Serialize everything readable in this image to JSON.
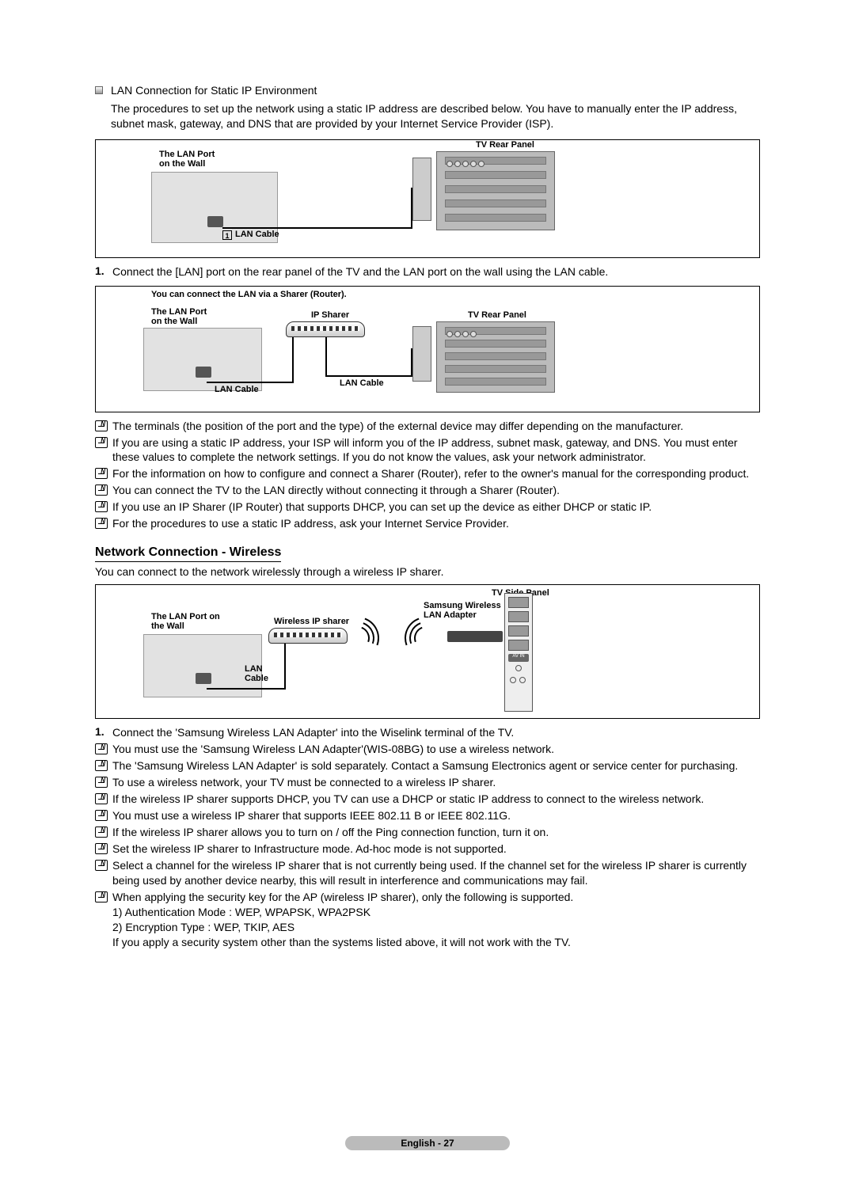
{
  "lan_static": {
    "title": "LAN Connection for Static IP Environment",
    "intro": "The procedures to set up the network using a static IP address are described below. You have to manually enter the IP address, subnet mask, gateway, and DNS that are provided by your Internet Service Provider (ISP)."
  },
  "diagram1": {
    "tv_label": "TV Rear Panel",
    "wall_label": "The LAN Port\non the Wall",
    "cable_num": "1",
    "cable_label": "LAN Cable"
  },
  "step1": {
    "num": "1.",
    "text": "Connect the [LAN] port on the rear panel of the TV and the LAN port on the wall using the LAN cable."
  },
  "diagram2": {
    "heading": "You can connect the LAN via a Sharer (Router).",
    "wall_label": "The LAN Port\non the Wall",
    "sharer_label": "IP Sharer",
    "tv_label": "TV Rear Panel",
    "cable1": "LAN Cable",
    "cable2": "LAN Cable"
  },
  "lan_notes": [
    "The terminals (the position of the port and the type) of the external device may differ depending on the manufacturer.",
    "If you are using a static IP address, your ISP will inform you of the IP address, subnet mask, gateway, and DNS. You must enter these values to complete the network settings. If you do not know the values, ask your network administrator.",
    "For the information on how to configure and connect a Sharer (Router), refer to the owner's manual for the corresponding product.",
    "You can connect the TV to the LAN directly without connecting it through a Sharer (Router).",
    "If you use an IP Sharer (IP Router) that supports DHCP, you can set up the device as either DHCP or static IP.",
    "For the procedures to use a static IP address, ask your Internet Service Provider."
  ],
  "wireless": {
    "heading": "Network Connection - Wireless",
    "intro": "You can connect to the network wirelessly through a wireless IP sharer."
  },
  "diagram3": {
    "side_label": "TV Side Panel",
    "wall_label": "The LAN Port on\nthe Wall",
    "sharer_label": "Wireless IP sharer",
    "adapter_label": "Samsung Wireless\nLAN Adapter",
    "cable_label": "LAN\nCable",
    "avin": "AV IN"
  },
  "wireless_step1": {
    "num": "1.",
    "text": "Connect the 'Samsung Wireless LAN Adapter' into the Wiselink terminal of the TV."
  },
  "wireless_notes": [
    "You must use the 'Samsung Wireless LAN Adapter'(WIS-08BG) to use a wireless network.",
    "The 'Samsung Wireless LAN Adapter' is sold separately. Contact a Samsung Electronics agent or service center for purchasing.",
    "To use a wireless network, your TV must be connected to a wireless IP sharer.",
    "If the wireless IP sharer supports DHCP, you TV can use a DHCP or static IP address to connect to the wireless network.",
    "You must use a wireless IP sharer that supports IEEE 802.11 B or IEEE 802.11G.",
    "If the wireless IP sharer allows you to turn on / off the Ping connection function, turn it on.",
    "Set the wireless IP sharer to Infrastructure mode. Ad-hoc mode is not supported.",
    "Select a channel for the wireless IP sharer that is not currently being used. If the channel set for the wireless IP sharer is currently being used by another device nearby, this will result in interference and communications may fail.",
    "When applying the security key for the AP (wireless IP sharer), only the following is supported.\n1) Authentication Mode : WEP, WPAPSK, WPA2PSK\n2) Encryption Type : WEP, TKIP, AES\nIf you apply a security system other than the systems listed above, it will not work with the TV."
  ],
  "footer": "English - 27"
}
